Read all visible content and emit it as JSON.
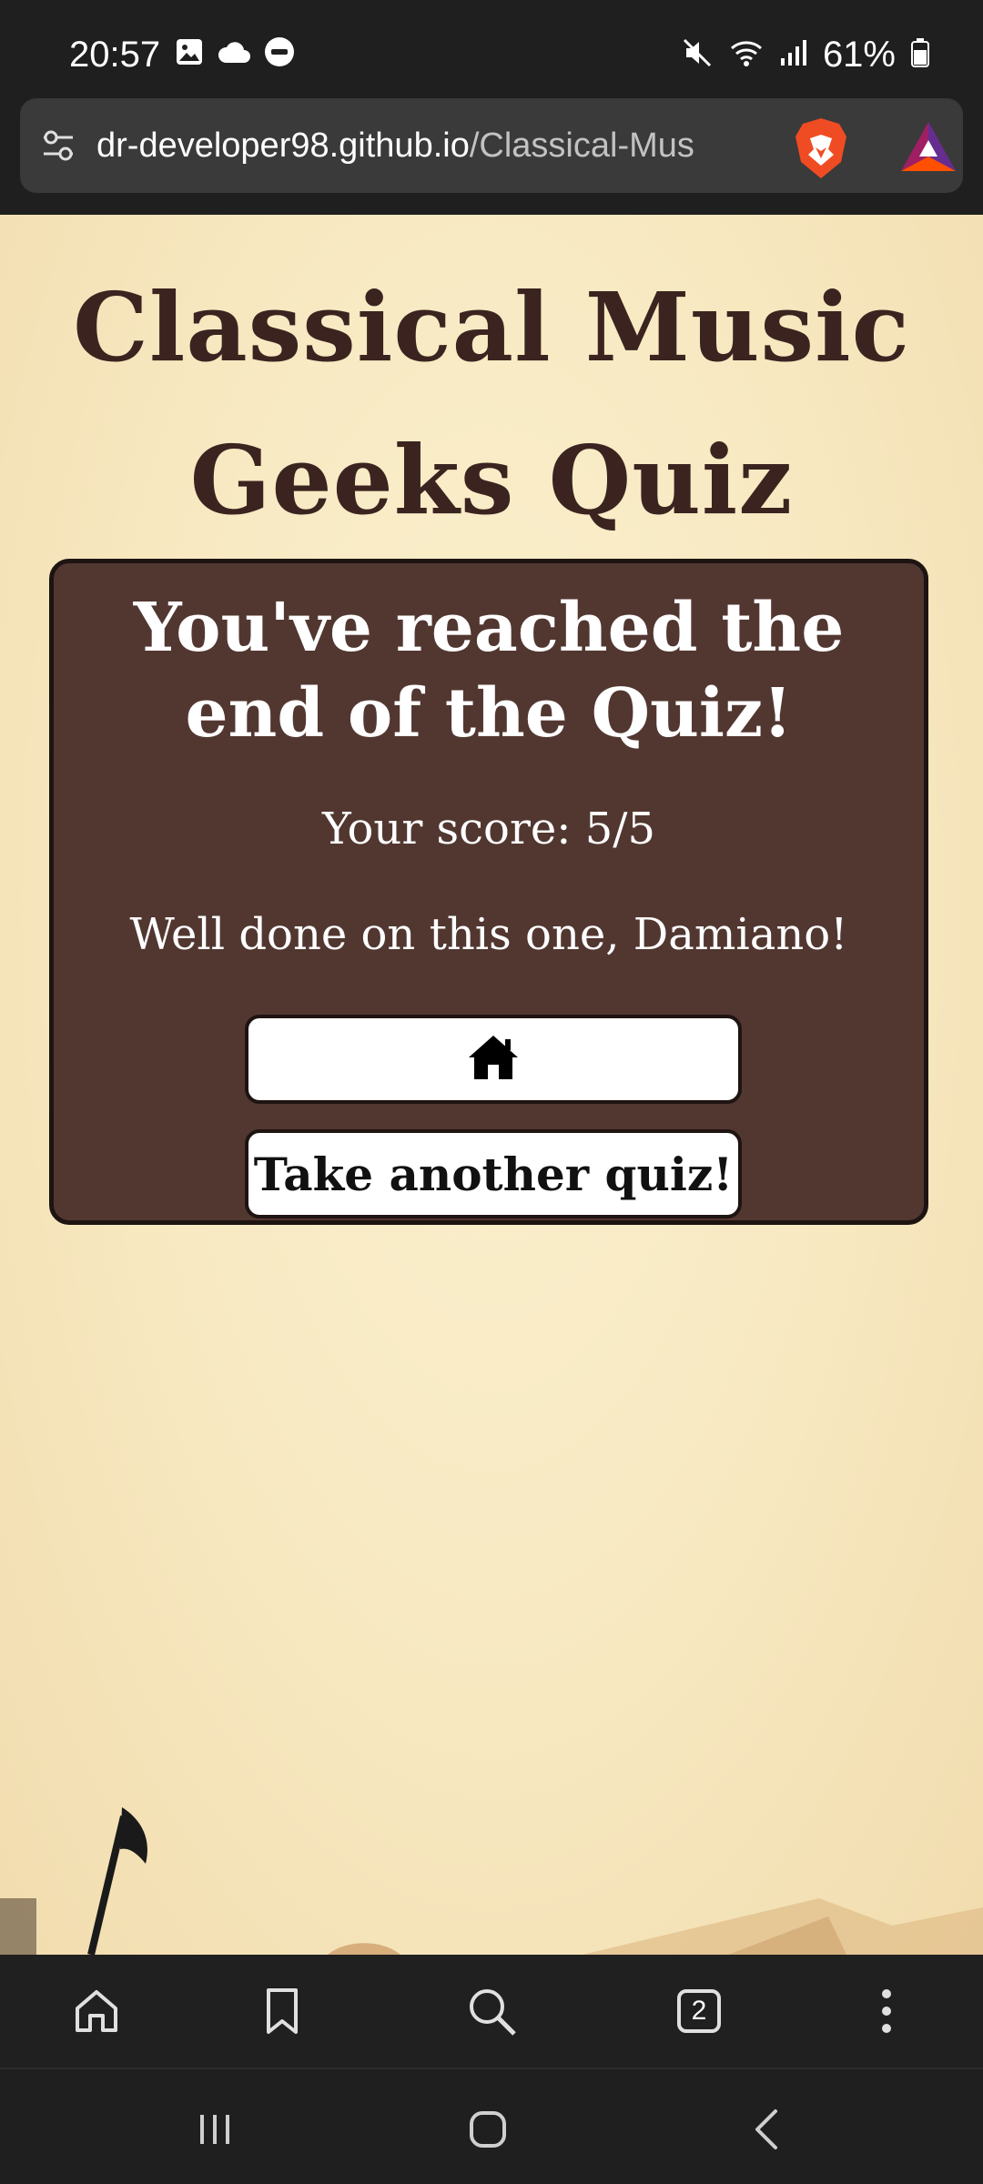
{
  "status_bar": {
    "time": "20:57",
    "battery_text": "61%",
    "left_icons": [
      "image-icon",
      "cloud-icon",
      "do-not-disturb-icon"
    ],
    "right_icons": [
      "mute-icon",
      "wifi-icon",
      "signal-icon",
      "battery-icon"
    ]
  },
  "browser": {
    "url_domain": "dr-developer98.github.io",
    "url_path": "/Classical-Mus",
    "icons": [
      "site-settings-icon",
      "brave-shields-icon",
      "brave-rewards-icon"
    ],
    "toolbar": {
      "items": [
        "home-icon",
        "bookmark-icon",
        "search-icon",
        "tabs-icon",
        "more-menu-icon"
      ],
      "tab_count": "2"
    }
  },
  "page": {
    "title": "Classical Music Geeks Quiz",
    "card": {
      "heading": "You've reached the end of the Quiz!",
      "score": "Your score: 5/5",
      "message": "Well done on this one, Damiano!",
      "home_button_icon": "home-icon",
      "another_button_label": "Take another quiz!"
    }
  },
  "system_nav": [
    "recent-apps-icon",
    "home-icon",
    "back-icon"
  ],
  "colors": {
    "card_bg": "#523731",
    "title_color": "#3b2420",
    "page_bg": "#f7e8c0"
  }
}
